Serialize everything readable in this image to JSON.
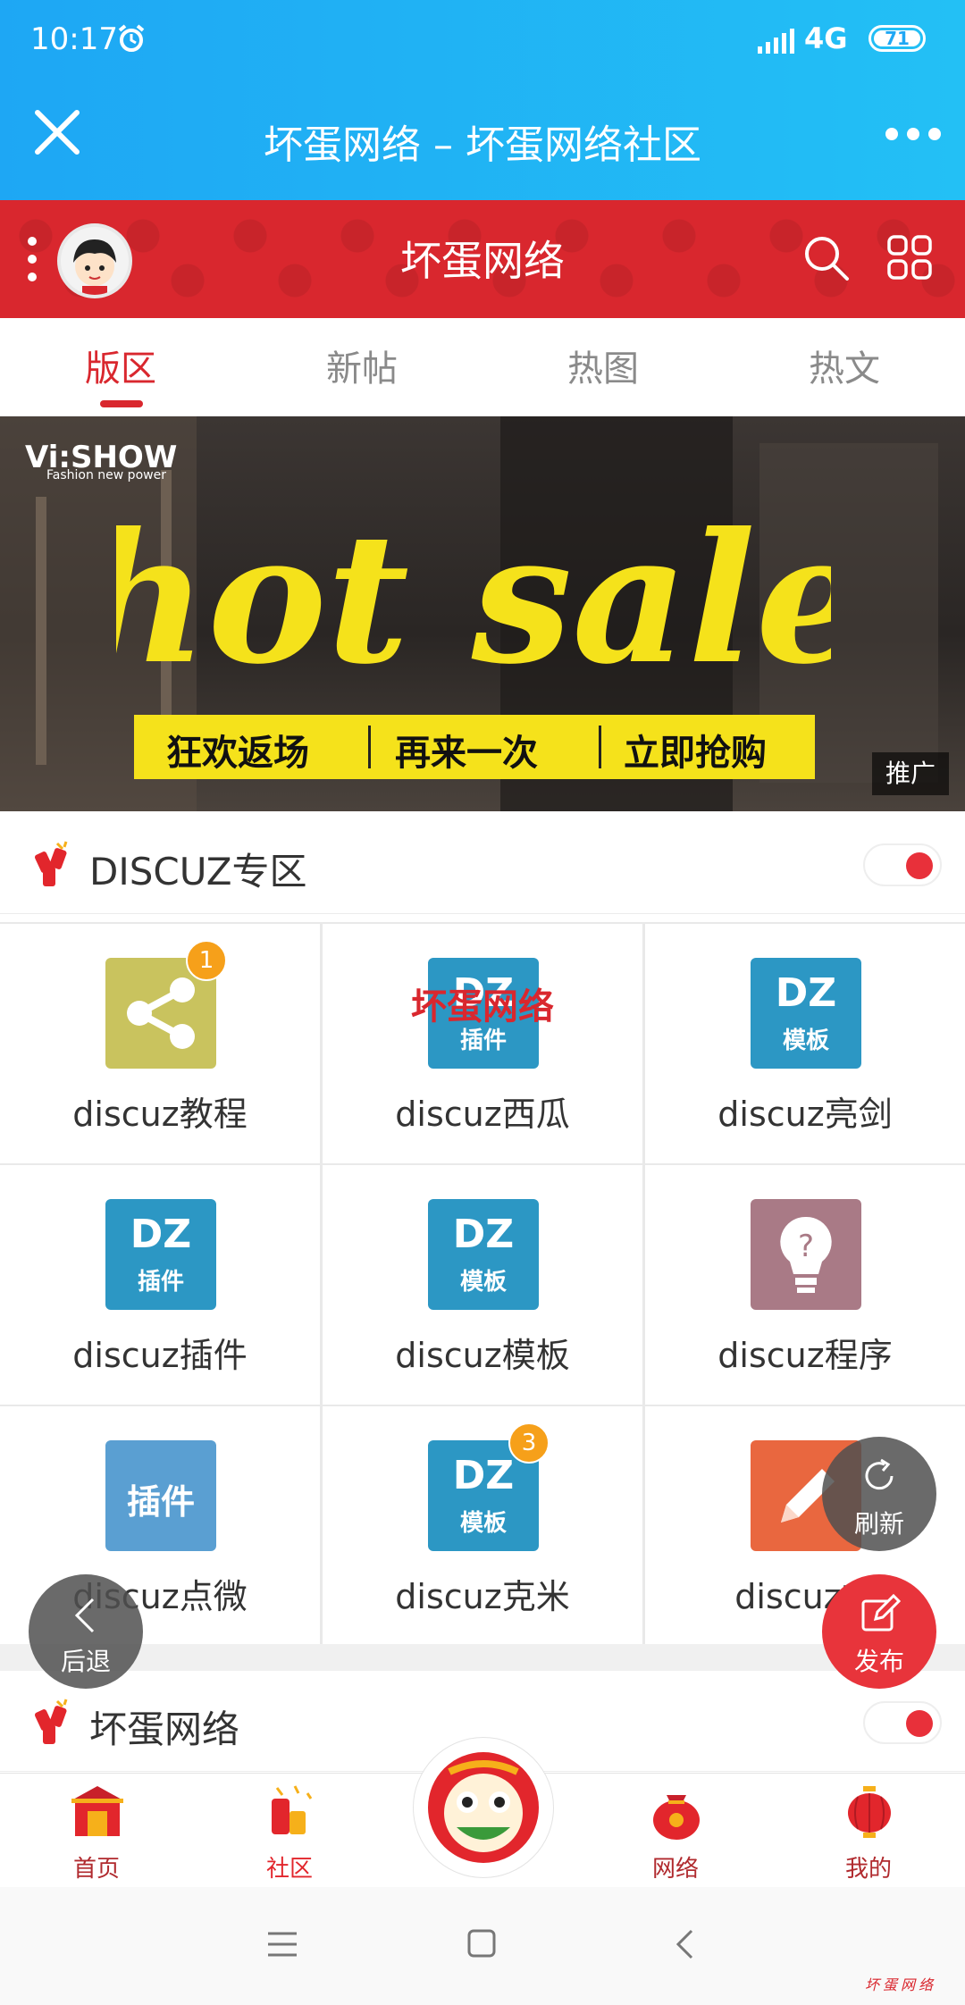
{
  "status_bar": {
    "time": "10:17",
    "network": "4G",
    "battery": "71"
  },
  "title_bar": {
    "title": "坏蛋网络 – 坏蛋网络社区"
  },
  "header": {
    "forum_name": "坏蛋网络"
  },
  "tabs": [
    {
      "label": "版区",
      "active": true
    },
    {
      "label": "新帖",
      "active": false
    },
    {
      "label": "热图",
      "active": false
    },
    {
      "label": "热文",
      "active": false
    }
  ],
  "banner": {
    "logo": "Vi:SHOW",
    "logo_sub": "Fashion new power",
    "headline": "hot sale",
    "strip": [
      "狂欢返场",
      "再来一次",
      "立即抢购"
    ],
    "promo_tag": "推广"
  },
  "section1": {
    "title": "DISCUZ专区",
    "toggle_on": true
  },
  "watermark": "坏蛋网络",
  "grid": [
    {
      "label": "discuz教程",
      "icon": "share-icon",
      "color": "#c9c35e",
      "badge": "1"
    },
    {
      "label": "discuz西瓜",
      "icon": "dz-plugin-icon",
      "color": "#2c97c4",
      "dz_top": "DZ",
      "dz_bottom": "插件"
    },
    {
      "label": "discuz亮剑",
      "icon": "dz-template-icon",
      "color": "#2c97c4",
      "dz_top": "DZ",
      "dz_bottom": "模板"
    },
    {
      "label": "discuz插件",
      "icon": "dz-plugin-icon",
      "color": "#2c97c4",
      "dz_top": "DZ",
      "dz_bottom": "插件"
    },
    {
      "label": "discuz模板",
      "icon": "dz-template-icon",
      "color": "#2c97c4",
      "dz_top": "DZ",
      "dz_bottom": "模板"
    },
    {
      "label": "discuz程序",
      "icon": "lightbulb-icon",
      "color": "#a97a86"
    },
    {
      "label": "discuz点微",
      "icon": "plugin-text-icon",
      "color": "#5a9fd2",
      "text": "插件"
    },
    {
      "label": "discuz克米",
      "icon": "dz-template-icon",
      "color": "#2c97c4",
      "dz_top": "DZ",
      "dz_bottom": "模板",
      "badge": "3"
    },
    {
      "label": "discuz求",
      "icon": "pencil-icon",
      "color": "#e9673f"
    }
  ],
  "section2": {
    "title": "坏蛋网络",
    "toggle_on": true
  },
  "floating": {
    "refresh": "刷新",
    "back": "后退",
    "post": "发布"
  },
  "bottom_nav": [
    {
      "label": "首页",
      "icon": "home-gate-icon"
    },
    {
      "label": "社区",
      "icon": "community-firecracker-icon"
    },
    {
      "label": "网络",
      "icon": "lucky-bag-icon"
    },
    {
      "label": "我的",
      "icon": "lantern-icon"
    }
  ],
  "footer_watermark": "坏蛋网络",
  "colors": {
    "accent_red": "#d9272e",
    "top_blue": "#1ea7f4",
    "badge_orange": "#f6a01a"
  }
}
